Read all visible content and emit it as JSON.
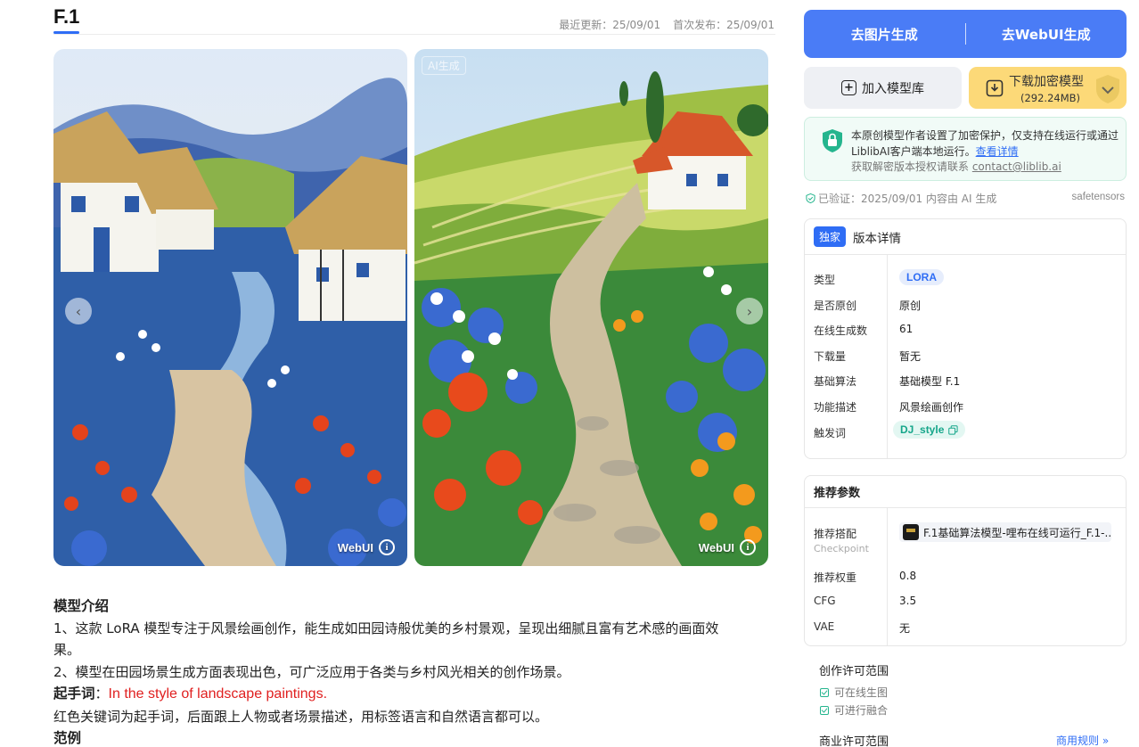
{
  "header": {
    "title": "F.1",
    "last_updated": "最近更新：25/09/01",
    "first_published": "首次发布：25/09/01"
  },
  "gallery": {
    "images": [
      {
        "label": "WebUI",
        "description": "thatched cottages beside a stream"
      },
      {
        "label": "WebUI",
        "description": "stone path through flower fields"
      }
    ],
    "watermark": "AI生成"
  },
  "description": {
    "heading": "模型介绍",
    "line1": "1、这款 LoRA 模型专注于风景绘画创作，能生成如田园诗般优美的乡村景观，呈现出细腻且富有艺术感的画面效",
    "line1b": "果。",
    "line2": "2、模型在田园场景生成方面表现出色，可广泛应用于各类与乡村风光相关的创作场景。",
    "trigger_label": "起手词",
    "trigger_sep": "：",
    "trigger_value": "In the style of landscape paintings.",
    "note": "红色关键词为起手词，后面跟上人物或者场景描述，用标签语言和自然语言都可以。",
    "example_heading": "范例"
  },
  "actions": {
    "generate_image": "去图片生成",
    "generate_webui": "去WebUI生成",
    "add_library": "加入模型库",
    "download": "下载加密模型",
    "download_size": "(292.24MB)"
  },
  "encrypt_notice": {
    "text": "本原创模型作者设置了加密保护，仅支持在线运行或通过LiblibAI客户端本地运行。",
    "link": "查看详情",
    "contact_prefix": "获取解密版本授权请联系 ",
    "contact_email": "contact@liblib.ai"
  },
  "verification": {
    "text": "已验证：2025/09/01 内容由 AI 生成",
    "format": "safetensors"
  },
  "version": {
    "badge": "独家",
    "title": "版本详情",
    "rows": [
      {
        "key": "类型",
        "value": "LORA"
      },
      {
        "key": "是否原创",
        "value": "原创"
      },
      {
        "key": "在线生成数",
        "value": "61"
      },
      {
        "key": "下载量",
        "value": "暂无"
      },
      {
        "key": "基础算法",
        "value": "基础模型 F.1"
      },
      {
        "key": "功能描述",
        "value": "风景绘画创作"
      },
      {
        "key": "触发词",
        "value": "DJ_style"
      }
    ]
  },
  "params": {
    "title": "推荐参数",
    "checkpoint_key": "推荐搭配",
    "checkpoint_sub": "Checkpoint",
    "checkpoint_value": "F.1基础算法模型-哩布在线可运行_F.1-...",
    "rows": [
      {
        "key": "推荐权重",
        "value": "0.8"
      },
      {
        "key": "CFG",
        "value": "3.5"
      },
      {
        "key": "VAE",
        "value": "无"
      }
    ]
  },
  "license": {
    "creation_title": "创作许可范围",
    "items": [
      "可在线生图",
      "可进行融合"
    ],
    "commercial_title": "商业许可范围",
    "rules_link": "商用规则 »"
  },
  "colors": {
    "accent": "#2f6df5",
    "primary_button": "#4a7cf6",
    "download_button": "#fcd978",
    "trigger_red": "#e02020"
  }
}
